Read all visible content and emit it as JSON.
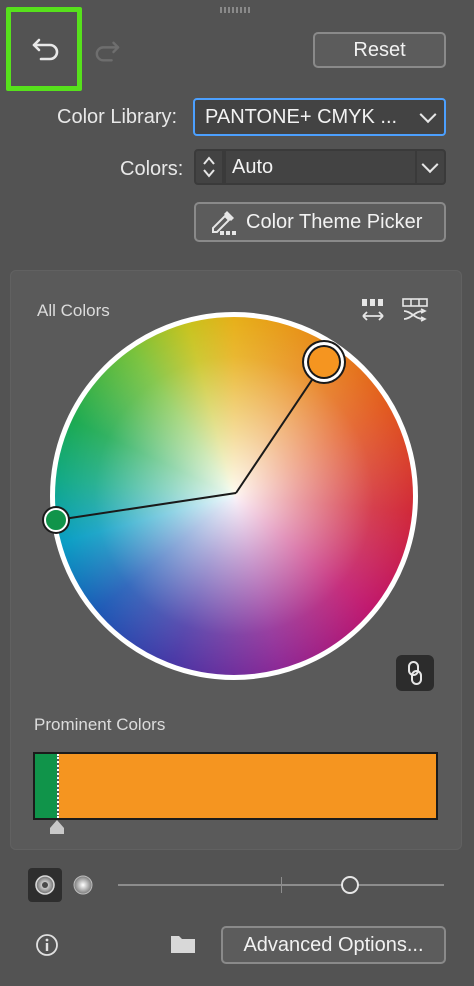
{
  "toolbar": {
    "undo_icon": "undo-icon",
    "redo_icon": "redo-icon",
    "reset_label": "Reset"
  },
  "color_library": {
    "label": "Color Library:",
    "value": "PANTONE+ CMYK ..."
  },
  "colors": {
    "label": "Colors:",
    "value": "Auto"
  },
  "theme_picker": {
    "label": "Color Theme Picker",
    "icon": "eyedropper-icon"
  },
  "all_colors": {
    "title": "All Colors",
    "icons": [
      "swatch-row-arrows-icon",
      "swatch-row-shuffle-icon"
    ],
    "handles": [
      {
        "name": "orange",
        "color": "#f59520"
      },
      {
        "name": "green",
        "color": "#10944a"
      }
    ],
    "link_icon": "link-icon"
  },
  "prominent": {
    "title": "Prominent Colors",
    "segments": [
      {
        "color": "#10944a",
        "fraction": 0.055
      },
      {
        "color": "#f59520",
        "fraction": 0.945
      }
    ]
  },
  "bottom": {
    "mode_icons": [
      "saturation-mode-icon",
      "brightness-mode-icon"
    ],
    "slider_level": 0.71,
    "info_icon": "info-icon",
    "folder_icon": "folder-icon",
    "advanced_label": "Advanced Options..."
  },
  "colors_theme": {
    "panel_bg": "#535353",
    "accent": "#4ca0ff",
    "highlight": "#57e11c"
  }
}
